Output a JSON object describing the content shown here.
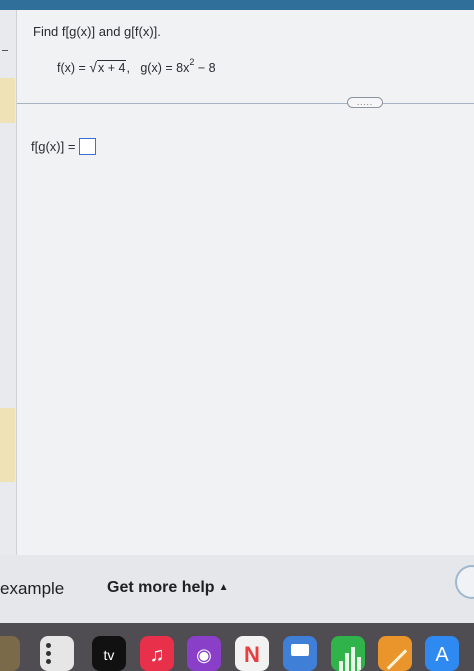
{
  "question": {
    "prompt": "Find f[g(x)] and g[f(x)]."
  },
  "given": {
    "f_lhs": "f(x) = ",
    "sqrt_symbol": "√",
    "f_radicand": "x + 4",
    "separator": ",",
    "g_lhs": "g(x) = 8x",
    "g_exponent": "2",
    "g_tail": " − 8"
  },
  "expand_pill": {
    "label": "....."
  },
  "answer": {
    "label": "f[g(x)] ="
  },
  "help_bar": {
    "example_label": "example",
    "help_label": "Get more help",
    "help_caret": "▲"
  },
  "dock": {
    "tv_label": "tv",
    "music_glyph": "♫",
    "podcast_glyph": "◉",
    "news_glyph": "N",
    "appstore_glyph": "A"
  },
  "colors": {
    "top_strip": "#2f6f9a",
    "answer_box_border": "#3b6fd6",
    "gutter_highlight": "#efe2b6"
  }
}
